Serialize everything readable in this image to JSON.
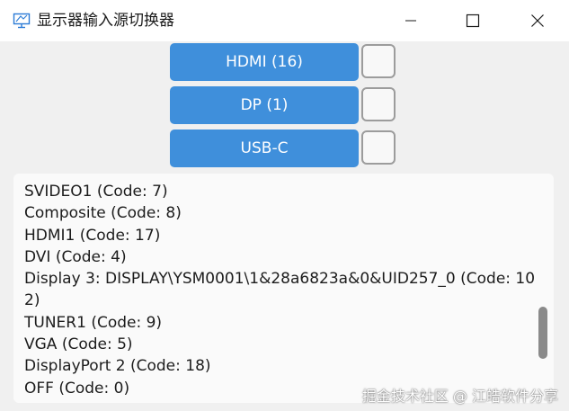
{
  "window": {
    "title": "显示器输入源切换器",
    "icon": "monitor-icon"
  },
  "sources": [
    {
      "label": "HDMI (16)",
      "checked": false
    },
    {
      "label": "DP (1)",
      "checked": false
    },
    {
      "label": "USB-C",
      "checked": false
    }
  ],
  "list": {
    "items": [
      "SVIDEO1 (Code: 7)",
      "Composite (Code: 8)",
      "HDMI1 (Code: 17)",
      "DVI (Code: 4)",
      "Display 3: DISPLAY\\YSM0001\\1&28a6823a&0&UID257_0 (Code: 102)",
      "TUNER1 (Code: 9)",
      "VGA (Code: 5)",
      "DisplayPort 2 (Code: 18)",
      "OFF (Code: 0)"
    ]
  },
  "watermark": "掘金技术社区 @ 江皓软件分享",
  "colors": {
    "button_blue": "#3f8fdb",
    "background": "#f0f0f0",
    "panel": "#fafafa"
  }
}
